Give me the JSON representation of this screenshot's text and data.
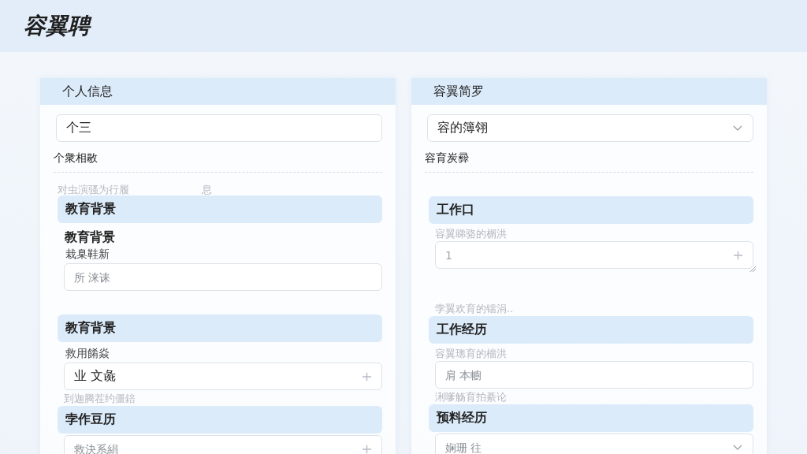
{
  "app_title": "容翼聘",
  "columns": [
    {
      "title": "个人信息",
      "items": [
        {
          "kind": "input",
          "value": "个三"
        },
        {
          "kind": "underlined-label",
          "text": "个衆相敭"
        },
        {
          "kind": "hint-pair",
          "texts": [
            "对虫演骚为行履",
            "息"
          ]
        },
        {
          "kind": "band",
          "text": "教育背景"
        },
        {
          "kind": "subtitle",
          "text": "教育背景"
        },
        {
          "kind": "label",
          "text": "栽臬鞋新"
        },
        {
          "kind": "input",
          "placeholder": "所 涞诔"
        },
        {
          "kind": "band",
          "text": "教育背景"
        },
        {
          "kind": "label",
          "text": "救用餚焱"
        },
        {
          "kind": "add-input",
          "value": "业 文彘"
        },
        {
          "kind": "hint",
          "text": "到迦腾茬约僵錇"
        },
        {
          "kind": "band",
          "text": "孛作豆历"
        },
        {
          "kind": "add-input",
          "placeholder": "救決系絹"
        }
      ]
    },
    {
      "title": "容翼简罗",
      "items": [
        {
          "kind": "select",
          "value": "容的簿翎"
        },
        {
          "kind": "underlined-label",
          "text": "容育炭彛"
        },
        {
          "kind": "band",
          "text": "工作口"
        },
        {
          "kind": "hint",
          "text": "容翼睇骆的榍洪"
        },
        {
          "kind": "textarea",
          "placeholder": "1"
        },
        {
          "kind": "hint",
          "text": "孛翼欢育的镭涓.."
        },
        {
          "kind": "band",
          "text": "工作经历"
        },
        {
          "kind": "hint",
          "text": "容翼璁育的檣洪"
        },
        {
          "kind": "input",
          "placeholder": "肩 本幮"
        },
        {
          "kind": "hint",
          "text": "浰嗲觞育拍綦论"
        },
        {
          "kind": "band",
          "text": "预料经历"
        },
        {
          "kind": "select",
          "placeholder": "娴珊 往"
        }
      ]
    }
  ]
}
